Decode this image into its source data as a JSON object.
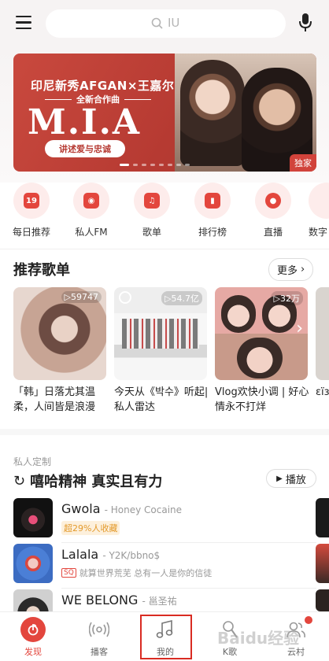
{
  "search": {
    "placeholder": "IU"
  },
  "banner": {
    "line1": "印尼新秀AFGAN×王嘉尔",
    "line2": "全新合作曲",
    "title": "M.I.A",
    "subtitle": "讲述爱与忠诚",
    "tag": "独家"
  },
  "quick": [
    {
      "label": "每日推荐",
      "icon": "calendar-icon",
      "glyph": "19"
    },
    {
      "label": "私人FM",
      "icon": "radio-icon",
      "glyph": ""
    },
    {
      "label": "歌单",
      "icon": "playlist-icon",
      "glyph": ""
    },
    {
      "label": "排行榜",
      "icon": "chart-icon",
      "glyph": ""
    },
    {
      "label": "直播",
      "icon": "live-icon",
      "glyph": ""
    },
    {
      "label": "数字",
      "icon": "digital-icon",
      "glyph": ""
    }
  ],
  "recommend": {
    "title": "推荐歌单",
    "more": "更多",
    "playlists": [
      {
        "count": "▷59747",
        "name": "「韩」日落尤其温柔，人间皆是浪漫"
      },
      {
        "count": "▷54.7亿",
        "name": "今天从《박수》听起|私人雷达"
      },
      {
        "count": "▷32万",
        "name": "Vlog欢快小调 | 好心情永不打烊"
      },
      {
        "count": "",
        "name": "εïз"
      }
    ]
  },
  "private": {
    "label": "私人定制",
    "title": "嘻哈精神 真实且有力",
    "play": "播放",
    "songs": [
      {
        "title": "Gwola",
        "artist": "- Honey Cocaine",
        "badge": "超29%人收藏",
        "desc": ""
      },
      {
        "title": "Lalala",
        "artist": "- Y2K/bbno$",
        "sq": "SQ",
        "desc": "就算世界荒芜 总有一人是你的信徒"
      },
      {
        "title": "WE BELONG",
        "artist": "- 邕圣祐",
        "desc": ""
      }
    ]
  },
  "nav": [
    {
      "label": "发现"
    },
    {
      "label": "播客"
    },
    {
      "label": "我的"
    },
    {
      "label": "K歌"
    },
    {
      "label": "云村"
    }
  ],
  "watermark": "Baidu经验",
  "colors": {
    "accent": "#e3463d",
    "highlight": "#d92b22"
  }
}
